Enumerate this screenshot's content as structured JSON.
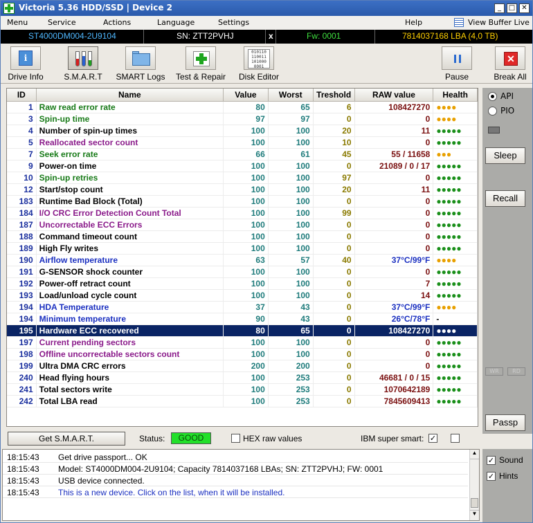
{
  "window": {
    "title": "Victoria 5.36 HDD/SSD | Device 2"
  },
  "menu": [
    "Menu",
    "Service",
    "Actions",
    "Language",
    "Settings",
    "Help"
  ],
  "view_buffer_live": "View Buffer Live",
  "drive": {
    "model": "ST4000DM004-2U9104",
    "serial": "SN: ZTT2PVHJ",
    "x": "x",
    "fw": "Fw: 0001",
    "lba": "7814037168 LBA (4,0 TB)"
  },
  "toolbar": {
    "drive_info": "Drive Info",
    "smart": "S.M.A.R.T",
    "smart_logs": "SMART Logs",
    "test_repair": "Test & Repair",
    "disk_editor": "Disk Editor",
    "pause": "Pause",
    "break_all": "Break All",
    "disk_editor_digits": "010110\n110011\n101000\n0001"
  },
  "table": {
    "headers": [
      "ID",
      "Name",
      "Value",
      "Worst",
      "Treshold",
      "RAW value",
      "Health"
    ],
    "rows": [
      {
        "id": "1",
        "name": "Raw read error rate",
        "value": "80",
        "worst": "65",
        "thr": "6",
        "raw": "108427270",
        "health": "●●●●",
        "nc": "#177a17",
        "hc": "#e8a000"
      },
      {
        "id": "3",
        "name": "Spin-up time",
        "value": "97",
        "worst": "97",
        "thr": "0",
        "raw": "0",
        "health": "●●●●",
        "nc": "#177a17",
        "hc": "#e8a000"
      },
      {
        "id": "4",
        "name": "Number of spin-up times",
        "value": "100",
        "worst": "100",
        "thr": "20",
        "raw": "11",
        "health": "●●●●●",
        "nc": "#000000",
        "hc": "#1a8f1a"
      },
      {
        "id": "5",
        "name": "Reallocated sector count",
        "value": "100",
        "worst": "100",
        "thr": "10",
        "raw": "0",
        "health": "●●●●●",
        "nc": "#8a1a8a",
        "hc": "#1a8f1a"
      },
      {
        "id": "7",
        "name": "Seek error rate",
        "value": "66",
        "worst": "61",
        "thr": "45",
        "raw": "55 / 11658",
        "health": "●●●",
        "nc": "#177a17",
        "hc": "#e8a000"
      },
      {
        "id": "9",
        "name": "Power-on time",
        "value": "100",
        "worst": "100",
        "thr": "0",
        "raw": "21089 / 0 / 17",
        "health": "●●●●●",
        "nc": "#000000",
        "hc": "#1a8f1a"
      },
      {
        "id": "10",
        "name": "Spin-up retries",
        "value": "100",
        "worst": "100",
        "thr": "97",
        "raw": "0",
        "health": "●●●●●",
        "nc": "#177a17",
        "hc": "#1a8f1a"
      },
      {
        "id": "12",
        "name": "Start/stop count",
        "value": "100",
        "worst": "100",
        "thr": "20",
        "raw": "11",
        "health": "●●●●●",
        "nc": "#000000",
        "hc": "#1a8f1a"
      },
      {
        "id": "183",
        "name": "Runtime Bad Block (Total)",
        "value": "100",
        "worst": "100",
        "thr": "0",
        "raw": "0",
        "health": "●●●●●",
        "nc": "#000000",
        "hc": "#1a8f1a"
      },
      {
        "id": "184",
        "name": "I/O CRC Error Detection Count Total",
        "value": "100",
        "worst": "100",
        "thr": "99",
        "raw": "0",
        "health": "●●●●●",
        "nc": "#8a1a8a",
        "hc": "#1a8f1a"
      },
      {
        "id": "187",
        "name": "Uncorrectable ECC Errors",
        "value": "100",
        "worst": "100",
        "thr": "0",
        "raw": "0",
        "health": "●●●●●",
        "nc": "#8a1a8a",
        "hc": "#1a8f1a"
      },
      {
        "id": "188",
        "name": "Command timeout count",
        "value": "100",
        "worst": "100",
        "thr": "0",
        "raw": "0",
        "health": "●●●●●",
        "nc": "#000000",
        "hc": "#1a8f1a"
      },
      {
        "id": "189",
        "name": "High Fly writes",
        "value": "100",
        "worst": "100",
        "thr": "0",
        "raw": "0",
        "health": "●●●●●",
        "nc": "#000000",
        "hc": "#1a8f1a"
      },
      {
        "id": "190",
        "name": "Airflow temperature",
        "value": "63",
        "worst": "57",
        "thr": "40",
        "raw": "37°C/99°F",
        "health": "●●●●",
        "nc": "#1a2fc0",
        "hc": "#e8a000",
        "rc": "#1a2fc0"
      },
      {
        "id": "191",
        "name": "G-SENSOR shock counter",
        "value": "100",
        "worst": "100",
        "thr": "0",
        "raw": "0",
        "health": "●●●●●",
        "nc": "#000000",
        "hc": "#1a8f1a"
      },
      {
        "id": "192",
        "name": "Power-off retract count",
        "value": "100",
        "worst": "100",
        "thr": "0",
        "raw": "7",
        "health": "●●●●●",
        "nc": "#000000",
        "hc": "#1a8f1a"
      },
      {
        "id": "193",
        "name": "Load/unload cycle count",
        "value": "100",
        "worst": "100",
        "thr": "0",
        "raw": "14",
        "health": "●●●●●",
        "nc": "#000000",
        "hc": "#1a8f1a"
      },
      {
        "id": "194",
        "name": "HDA Temperature",
        "value": "37",
        "worst": "43",
        "thr": "0",
        "raw": "37°C/99°F",
        "health": "●●●●",
        "nc": "#1a2fc0",
        "hc": "#e8a000",
        "rc": "#1a2fc0"
      },
      {
        "id": "194",
        "name": "Minimum temperature",
        "value": "90",
        "worst": "43",
        "thr": "0",
        "raw": "26°C/78°F",
        "health": "-",
        "nc": "#1a2fc0",
        "hc": "#000000",
        "rc": "#1a2fc0"
      },
      {
        "id": "195",
        "name": "Hardware ECC recovered",
        "value": "80",
        "worst": "65",
        "thr": "0",
        "raw": "108427270",
        "health": "●●●●",
        "nc": "#ffffff",
        "hc": "#ffffff",
        "sel": true
      },
      {
        "id": "197",
        "name": "Current pending sectors",
        "value": "100",
        "worst": "100",
        "thr": "0",
        "raw": "0",
        "health": "●●●●●",
        "nc": "#8a1a8a",
        "hc": "#1a8f1a"
      },
      {
        "id": "198",
        "name": "Offline uncorrectable sectors count",
        "value": "100",
        "worst": "100",
        "thr": "0",
        "raw": "0",
        "health": "●●●●●",
        "nc": "#8a1a8a",
        "hc": "#1a8f1a"
      },
      {
        "id": "199",
        "name": "Ultra DMA CRC errors",
        "value": "200",
        "worst": "200",
        "thr": "0",
        "raw": "0",
        "health": "●●●●●",
        "nc": "#000000",
        "hc": "#1a8f1a"
      },
      {
        "id": "240",
        "name": "Head flying hours",
        "value": "100",
        "worst": "253",
        "thr": "0",
        "raw": "46681 / 0 / 15",
        "health": "●●●●●",
        "nc": "#000000",
        "hc": "#1a8f1a"
      },
      {
        "id": "241",
        "name": "Total sectors write",
        "value": "100",
        "worst": "253",
        "thr": "0",
        "raw": "1070642189",
        "health": "●●●●●",
        "nc": "#000000",
        "hc": "#1a8f1a"
      },
      {
        "id": "242",
        "name": "Total LBA read",
        "value": "100",
        "worst": "253",
        "thr": "0",
        "raw": "7845609413",
        "health": "●●●●●",
        "nc": "#000000",
        "hc": "#1a8f1a"
      }
    ]
  },
  "side": {
    "api": "API",
    "pio": "PIO",
    "sleep": "Sleep",
    "recall": "Recall",
    "passp": "Passp",
    "wr": "WR",
    "rd": "RD"
  },
  "status": {
    "get_smart": "Get S.M.A.R.T.",
    "status_label": "Status:",
    "status_value": "GOOD",
    "hex_raw": "HEX raw values",
    "ibm": "IBM super smart:"
  },
  "log": [
    {
      "time": "18:15:43",
      "msg": "Get drive passport... OK",
      "color": "#000000"
    },
    {
      "time": "18:15:43",
      "msg": "Model: ST4000DM004-2U9104; Capacity 7814037168 LBAs; SN: ZTT2PVHJ; FW: 0001",
      "color": "#000000"
    },
    {
      "time": "18:15:43",
      "msg": "USB device connected.",
      "color": "#000000"
    },
    {
      "time": "18:15:43",
      "msg": "This is a new device. Click on the list, when it will be installed.",
      "color": "#1a2fc0"
    }
  ],
  "options": {
    "sound": "Sound",
    "hints": "Hints"
  }
}
